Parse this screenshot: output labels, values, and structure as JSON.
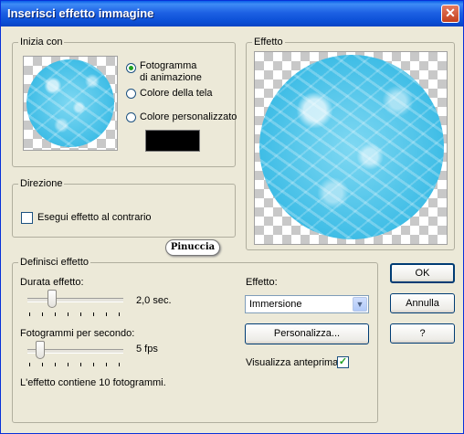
{
  "window": {
    "title": "Inserisci effetto immagine",
    "close_icon": "close-icon"
  },
  "start_with": {
    "legend": "Inizia con",
    "options": [
      {
        "label": "Fotogramma\ndi animazione",
        "line1": "Fotogramma",
        "line2": "di animazione",
        "checked": true
      },
      {
        "label": "Colore della tela",
        "checked": false
      },
      {
        "label": "Colore personalizzato",
        "checked": false
      }
    ],
    "custom_color": "#000000"
  },
  "preview": {
    "legend": "Effetto"
  },
  "direction": {
    "legend": "Direzione",
    "reverse_label": "Esegui effetto al contrario",
    "reverse_checked": false
  },
  "watermark": "Pinuccia",
  "define": {
    "legend": "Definisci effetto",
    "duration_label": "Durata effetto:",
    "duration_value": "2,0 sec.",
    "duration_fraction": 0.2,
    "fps_label": "Fotogrammi per secondo:",
    "fps_value": "5 fps",
    "fps_fraction": 0.1,
    "frames_note": "L'effetto contiene 10 fotogrammi.",
    "effect_label": "Effetto:",
    "effect_selected": "Immersione",
    "customize_button": "Personalizza...",
    "show_preview_label": "Visualizza anteprima",
    "show_preview_checked": true
  },
  "buttons": {
    "ok": "OK",
    "cancel": "Annulla",
    "help": "?"
  },
  "colors": {
    "title_bar": "#0a5fe8",
    "water": "#3fbde6",
    "radio_dot": "#21a121"
  }
}
